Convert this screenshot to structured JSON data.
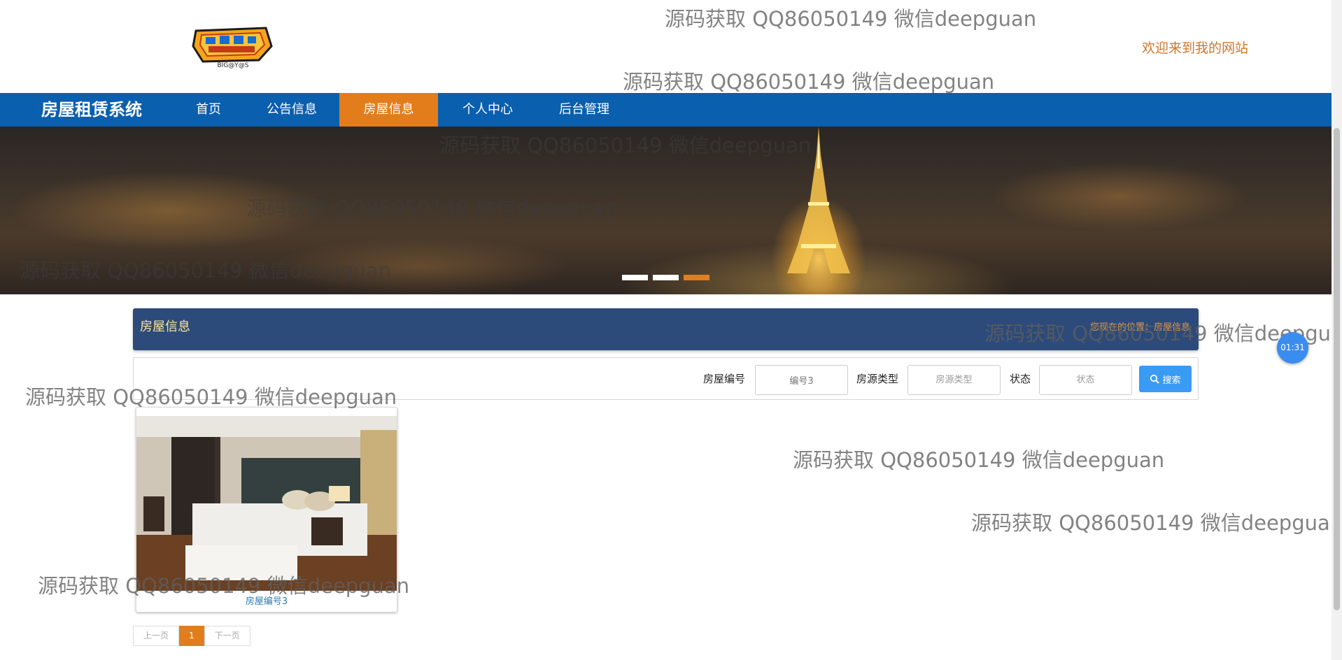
{
  "header": {
    "logo_text": "BIG@Y@S",
    "welcome": "欢迎来到我的网站"
  },
  "nav": {
    "brand": "房屋租赁系统",
    "items": [
      {
        "label": "首页",
        "active": false
      },
      {
        "label": "公告信息",
        "active": false
      },
      {
        "label": "房屋信息",
        "active": true
      },
      {
        "label": "个人中心",
        "active": false
      },
      {
        "label": "后台管理",
        "active": false
      }
    ]
  },
  "banner": {
    "slides": 3,
    "active_slide": 3
  },
  "panel": {
    "title": "房屋信息",
    "breadcrumb": "您现在的位置：房屋信息"
  },
  "search": {
    "fields": [
      {
        "label": "房屋编号",
        "value": "编号3",
        "placeholder": "房屋编号"
      },
      {
        "label": "房源类型",
        "value": "",
        "placeholder": "房源类型"
      },
      {
        "label": "状态",
        "value": "",
        "placeholder": "状态"
      }
    ],
    "button_label": "搜索"
  },
  "cards": [
    {
      "title": "房屋编号3"
    }
  ],
  "pagination": {
    "prev": "上一页",
    "current": "1",
    "next": "下一页"
  },
  "watermark": "源码获取 QQ86050149 微信deepguan",
  "timer": "01:31",
  "colors": {
    "nav_bg": "#0a5fae",
    "accent": "#e37d1c",
    "panel_bg": "#2c4a7a",
    "search_button": "#3a9bf5"
  }
}
